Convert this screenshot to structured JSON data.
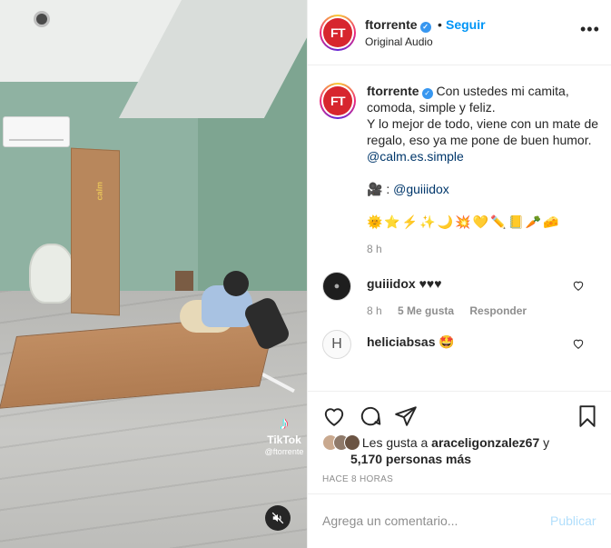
{
  "video": {
    "tiktok_brand": "TikTok",
    "tiktok_handle": "@ftorrente",
    "box_print": "calm"
  },
  "header": {
    "avatar_text": "FT",
    "username": "ftorrente",
    "separator": "•",
    "follow_label": "Seguir",
    "audio": "Original Audio",
    "more_label": "•••"
  },
  "caption": {
    "username": "ftorrente",
    "line1": "Con ustedes mi camita, comoda, simple y feliz.",
    "line2": "Y lo mejor de todo, viene con un mate de regalo, eso ya me pone de buen humor.",
    "mention": "@calm.es.simple",
    "credit_icon": "🎥",
    "credit_sep": " : ",
    "credit_mention": "@guiiidox",
    "emojis": "🌞⭐⚡✨🌙💥💛✏️📒🥕🧀",
    "time": "8 h"
  },
  "comments": [
    {
      "username": "guiiidox",
      "text": "♥♥♥",
      "time": "8 h",
      "likes": "5 Me gusta",
      "reply": "Responder"
    },
    {
      "username": "heliciabsas",
      "text": "🤩",
      "avatar_letter": "H"
    }
  ],
  "actions": {
    "likes_prefix": "Les gusta a",
    "likes_user": "araceligonzalez67",
    "likes_conj": "y",
    "likes_others": "5,170 personas más",
    "timestamp": "HACE 8 HORAS"
  },
  "composer": {
    "placeholder": "Agrega un comentario...",
    "publish": "Publicar"
  },
  "colors": {
    "link": "#0095f6",
    "mention": "#00376b",
    "brand_red": "#d7262e"
  }
}
